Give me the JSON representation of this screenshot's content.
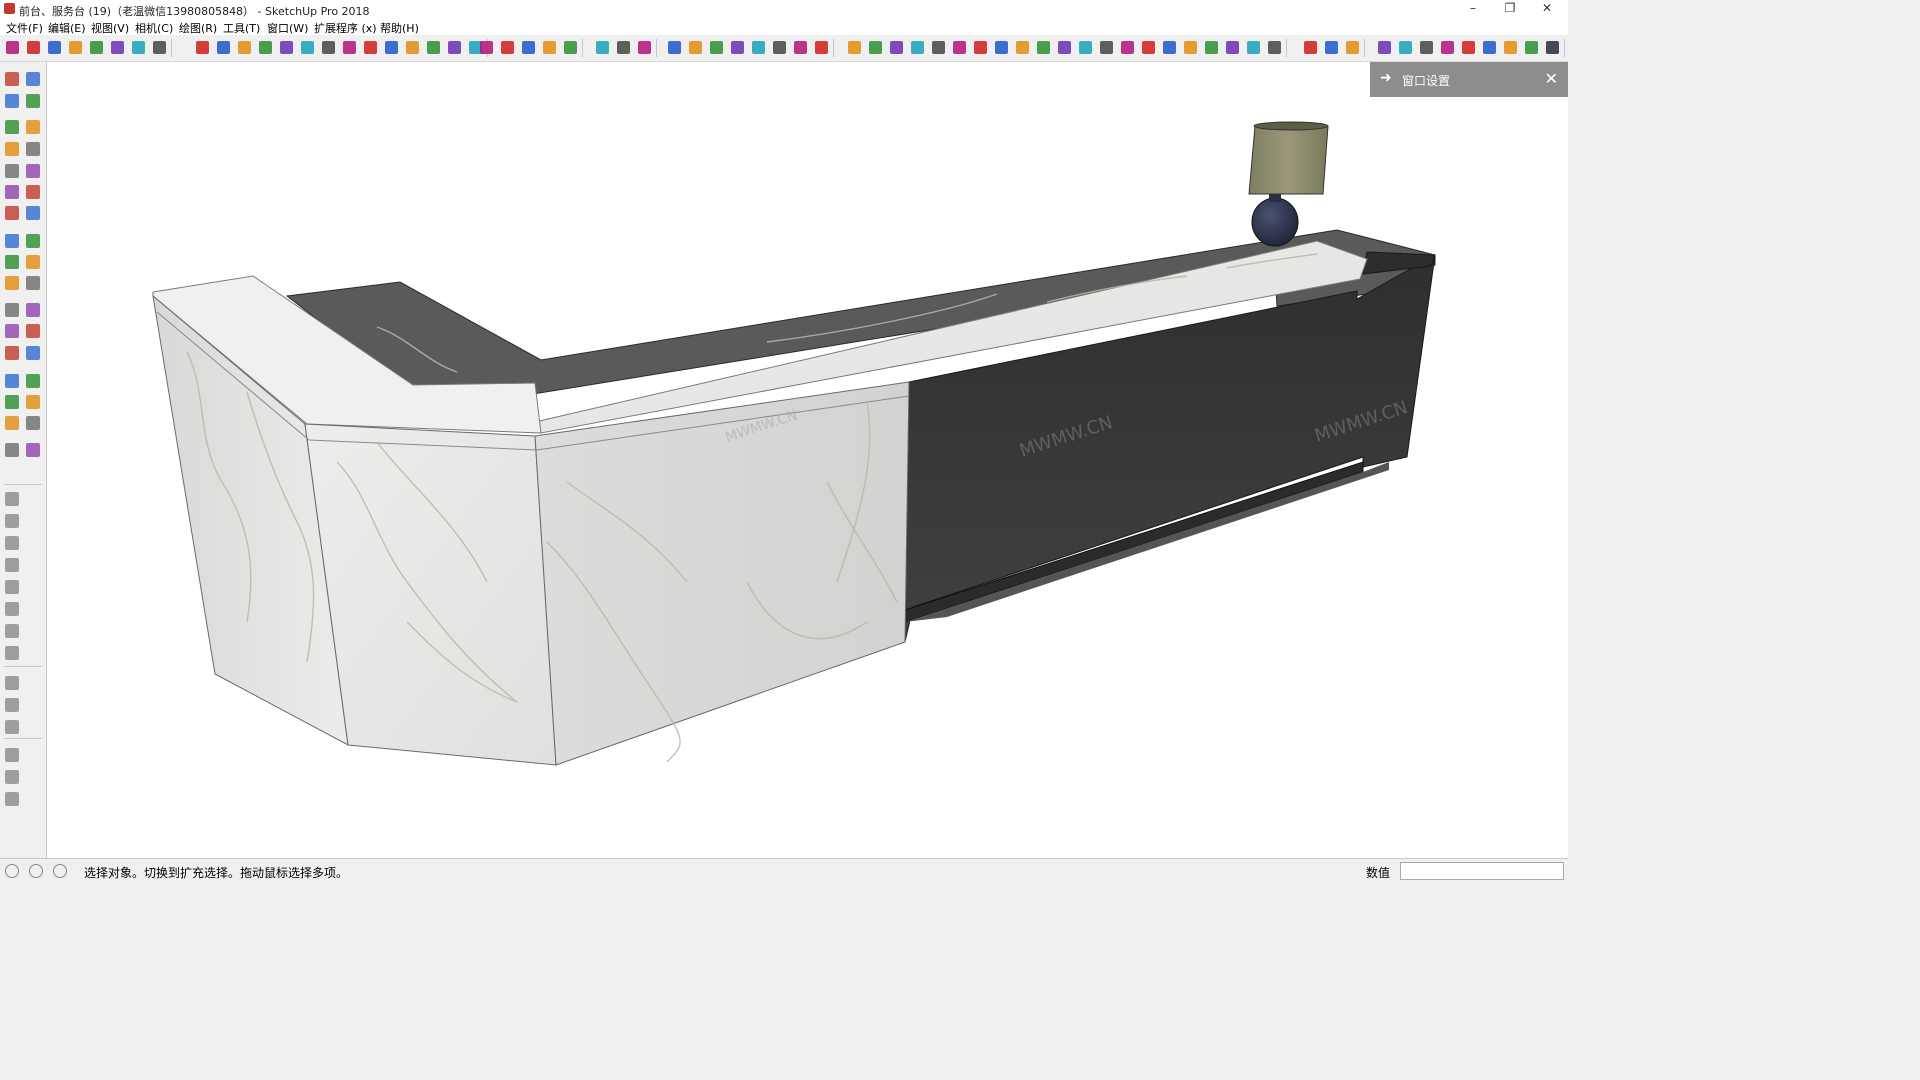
{
  "window": {
    "title": "前台、服务台 (19)（老温微信13980805848） - SketchUp Pro 2018",
    "minimize": "–",
    "restore": "❐",
    "close": "✕"
  },
  "menu": [
    "文件(F)",
    "编辑(E)",
    "视图(V)",
    "相机(C)",
    "绘图(R)",
    "工具(T)",
    "窗口(W)",
    "扩展程序 (x)",
    "帮助(H)"
  ],
  "tray": {
    "title": "窗口设置",
    "arrow": "➜",
    "close": "✕"
  },
  "watermarks": [
    "MWMW.CN",
    "MWMW.CN",
    "MWMW.CN"
  ],
  "status": {
    "message": "选择对象。切换到扩充选择。拖动鼠标选择多项。",
    "measure_label": "数值",
    "measure_value": ""
  },
  "colors": {
    "marble": "#e6e6e4",
    "marble_top": "#f1f1ef",
    "dark_panel": "#3a3b3d",
    "counter_gray": "#5a5a5a",
    "lamp_shade": "#8c8b6c",
    "lamp_base": "#2b3146"
  }
}
